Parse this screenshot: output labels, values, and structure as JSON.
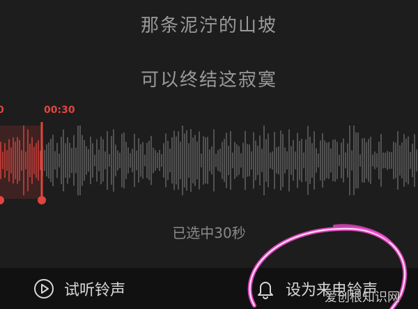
{
  "lyrics": {
    "line1": "那条泥泞的山坡",
    "line2": "可以终结这寂寞"
  },
  "waveform": {
    "start_time_label": "0",
    "end_time_label": "00:30",
    "selected_color": "#e0453f",
    "unselected_color": "#6a6a6a"
  },
  "selection": {
    "info": "已选中30秒"
  },
  "bottom_bar": {
    "preview_label": "试听铃声",
    "set_label": "设为来电铃声"
  },
  "watermark": "爱创根知识网"
}
